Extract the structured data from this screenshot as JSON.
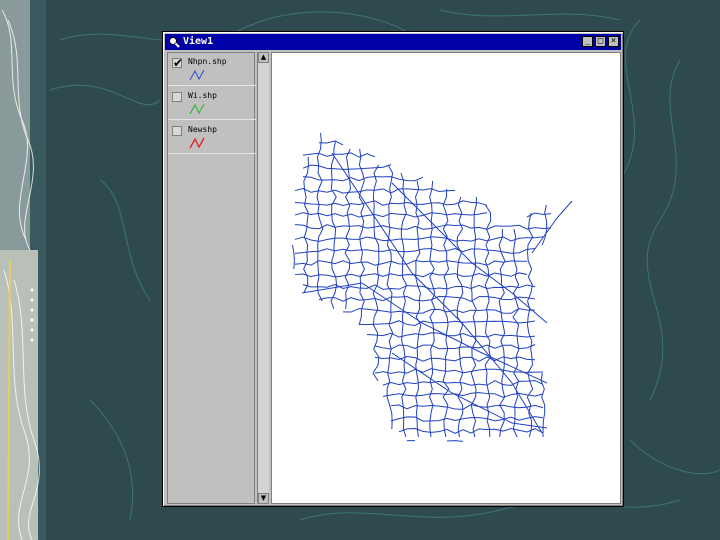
{
  "window": {
    "title": "View1",
    "buttons": {
      "minimize": "_",
      "maximize": "□",
      "close": "×"
    }
  },
  "toc": {
    "layers": [
      {
        "name": "Nhpn.shp",
        "checked": true,
        "color": "#3050c8",
        "icon": "line-symbol-icon"
      },
      {
        "name": "Wi.shp",
        "checked": false,
        "color": "#30b030",
        "icon": "line-symbol-icon"
      },
      {
        "name": "Newshp",
        "checked": false,
        "color": "#e02020",
        "icon": "line-symbol-icon"
      }
    ],
    "check_mark": "✔"
  },
  "scrollbar": {
    "up": "▲",
    "down": "▼"
  },
  "map": {
    "road_color": "#2040c0",
    "background": "#ffffff"
  }
}
